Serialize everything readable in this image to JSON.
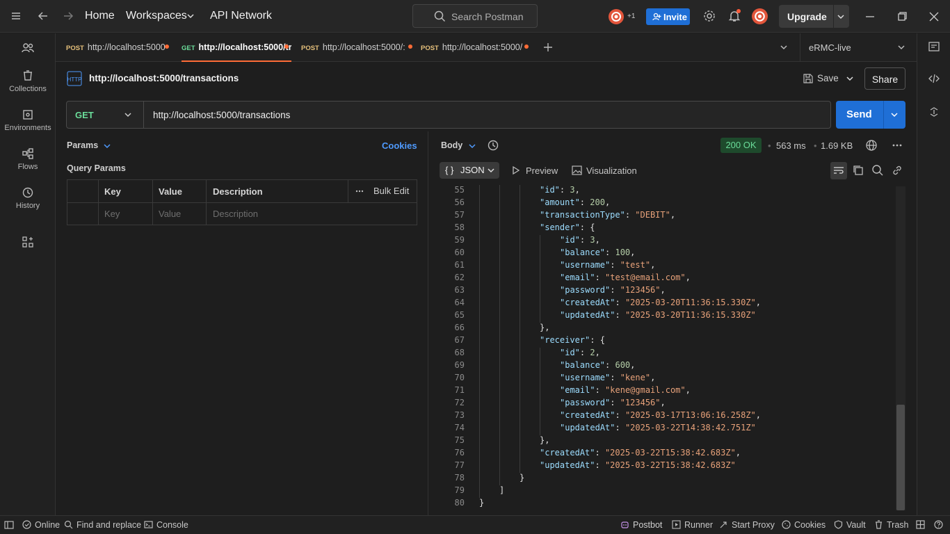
{
  "topbar": {
    "nav_home": "Home",
    "nav_workspaces": "Workspaces",
    "nav_api_network": "API Network",
    "search_placeholder": "Search Postman",
    "collab_count": "+1",
    "invite_label": "Invite",
    "upgrade_label": "Upgrade"
  },
  "sidebar": {
    "items": [
      {
        "label": "Collections",
        "icon": "collections-icon"
      },
      {
        "label": "Environments",
        "icon": "environments-icon"
      },
      {
        "label": "Flows",
        "icon": "flows-icon"
      },
      {
        "label": "History",
        "icon": "history-icon"
      }
    ]
  },
  "tabs": [
    {
      "method": "POST",
      "url": "http://localhost:5000",
      "method_color": "#e5c07b"
    },
    {
      "method": "GET",
      "url": "http://localhost:5000/tr",
      "method_color": "#6bdd9a"
    },
    {
      "method": "POST",
      "url": "http://localhost:5000/:",
      "method_color": "#e5c07b"
    },
    {
      "method": "POST",
      "url": "http://localhost:5000/",
      "method_color": "#e5c07b"
    }
  ],
  "environment": {
    "selected": "eRMC-live"
  },
  "request": {
    "title": "http://localhost:5000/transactions",
    "save_label": "Save",
    "share_label": "Share",
    "method": "GET",
    "url": "http://localhost:5000/transactions",
    "send_label": "Send"
  },
  "params": {
    "label": "Params",
    "cookies_label": "Cookies",
    "query_title": "Query Params",
    "columns": [
      "Key",
      "Value",
      "Description"
    ],
    "bulk_edit": "Bulk Edit",
    "placeholders": {
      "key": "Key",
      "value": "Value",
      "description": "Description"
    }
  },
  "response": {
    "body_label": "Body",
    "status": "200 OK",
    "time": "563 ms",
    "size": "1.69 KB",
    "format": "JSON",
    "preview_label": "Preview",
    "visualization_label": "Visualization",
    "lines": [
      {
        "n": "55",
        "d": 3,
        "t": [
          [
            "k",
            "\"id\""
          ],
          [
            "p",
            ": "
          ],
          [
            "n",
            "3"
          ],
          [
            "p",
            ","
          ]
        ]
      },
      {
        "n": "56",
        "d": 3,
        "t": [
          [
            "k",
            "\"amount\""
          ],
          [
            "p",
            ": "
          ],
          [
            "n",
            "200"
          ],
          [
            "p",
            ","
          ]
        ]
      },
      {
        "n": "57",
        "d": 3,
        "t": [
          [
            "k",
            "\"transactionType\""
          ],
          [
            "p",
            ": "
          ],
          [
            "s",
            "\"DEBIT\""
          ],
          [
            "p",
            ","
          ]
        ]
      },
      {
        "n": "58",
        "d": 3,
        "t": [
          [
            "k",
            "\"sender\""
          ],
          [
            "p",
            ": {"
          ]
        ]
      },
      {
        "n": "59",
        "d": 4,
        "t": [
          [
            "k",
            "\"id\""
          ],
          [
            "p",
            ": "
          ],
          [
            "n",
            "3"
          ],
          [
            "p",
            ","
          ]
        ]
      },
      {
        "n": "60",
        "d": 4,
        "t": [
          [
            "k",
            "\"balance\""
          ],
          [
            "p",
            ": "
          ],
          [
            "n",
            "100"
          ],
          [
            "p",
            ","
          ]
        ]
      },
      {
        "n": "61",
        "d": 4,
        "t": [
          [
            "k",
            "\"username\""
          ],
          [
            "p",
            ": "
          ],
          [
            "s",
            "\"test\""
          ],
          [
            "p",
            ","
          ]
        ]
      },
      {
        "n": "62",
        "d": 4,
        "t": [
          [
            "k",
            "\"email\""
          ],
          [
            "p",
            ": "
          ],
          [
            "s",
            "\"test@email.com\""
          ],
          [
            "p",
            ","
          ]
        ]
      },
      {
        "n": "63",
        "d": 4,
        "t": [
          [
            "k",
            "\"password\""
          ],
          [
            "p",
            ": "
          ],
          [
            "s",
            "\"123456\""
          ],
          [
            "p",
            ","
          ]
        ]
      },
      {
        "n": "64",
        "d": 4,
        "t": [
          [
            "k",
            "\"createdAt\""
          ],
          [
            "p",
            ": "
          ],
          [
            "s",
            "\"2025-03-20T11:36:15.330Z\""
          ],
          [
            "p",
            ","
          ]
        ]
      },
      {
        "n": "65",
        "d": 4,
        "t": [
          [
            "k",
            "\"updatedAt\""
          ],
          [
            "p",
            ": "
          ],
          [
            "s",
            "\"2025-03-20T11:36:15.330Z\""
          ]
        ]
      },
      {
        "n": "66",
        "d": 3,
        "t": [
          [
            "p",
            "},"
          ]
        ]
      },
      {
        "n": "67",
        "d": 3,
        "t": [
          [
            "k",
            "\"receiver\""
          ],
          [
            "p",
            ": {"
          ]
        ]
      },
      {
        "n": "68",
        "d": 4,
        "t": [
          [
            "k",
            "\"id\""
          ],
          [
            "p",
            ": "
          ],
          [
            "n",
            "2"
          ],
          [
            "p",
            ","
          ]
        ]
      },
      {
        "n": "69",
        "d": 4,
        "t": [
          [
            "k",
            "\"balance\""
          ],
          [
            "p",
            ": "
          ],
          [
            "n",
            "600"
          ],
          [
            "p",
            ","
          ]
        ]
      },
      {
        "n": "70",
        "d": 4,
        "t": [
          [
            "k",
            "\"username\""
          ],
          [
            "p",
            ": "
          ],
          [
            "s",
            "\"kene\""
          ],
          [
            "p",
            ","
          ]
        ]
      },
      {
        "n": "71",
        "d": 4,
        "t": [
          [
            "k",
            "\"email\""
          ],
          [
            "p",
            ": "
          ],
          [
            "s",
            "\"kene@gmail.com\""
          ],
          [
            "p",
            ","
          ]
        ]
      },
      {
        "n": "72",
        "d": 4,
        "t": [
          [
            "k",
            "\"password\""
          ],
          [
            "p",
            ": "
          ],
          [
            "s",
            "\"123456\""
          ],
          [
            "p",
            ","
          ]
        ]
      },
      {
        "n": "73",
        "d": 4,
        "t": [
          [
            "k",
            "\"createdAt\""
          ],
          [
            "p",
            ": "
          ],
          [
            "s",
            "\"2025-03-17T13:06:16.258Z\""
          ],
          [
            "p",
            ","
          ]
        ]
      },
      {
        "n": "74",
        "d": 4,
        "t": [
          [
            "k",
            "\"updatedAt\""
          ],
          [
            "p",
            ": "
          ],
          [
            "s",
            "\"2025-03-22T14:38:42.751Z\""
          ]
        ]
      },
      {
        "n": "75",
        "d": 3,
        "t": [
          [
            "p",
            "},"
          ]
        ]
      },
      {
        "n": "76",
        "d": 3,
        "t": [
          [
            "k",
            "\"createdAt\""
          ],
          [
            "p",
            ": "
          ],
          [
            "s",
            "\"2025-03-22T15:38:42.683Z\""
          ],
          [
            "p",
            ","
          ]
        ]
      },
      {
        "n": "77",
        "d": 3,
        "t": [
          [
            "k",
            "\"updatedAt\""
          ],
          [
            "p",
            ": "
          ],
          [
            "s",
            "\"2025-03-22T15:38:42.683Z\""
          ]
        ]
      },
      {
        "n": "78",
        "d": 2,
        "t": [
          [
            "p",
            "}"
          ]
        ]
      },
      {
        "n": "79",
        "d": 1,
        "t": [
          [
            "p",
            "]"
          ]
        ]
      },
      {
        "n": "80",
        "d": 0,
        "t": [
          [
            "p",
            "}"
          ]
        ]
      }
    ]
  },
  "statusbar": {
    "online": "Online",
    "find_replace": "Find and replace",
    "console": "Console",
    "postbot": "Postbot",
    "runner": "Runner",
    "start_proxy": "Start Proxy",
    "cookies": "Cookies",
    "vault": "Vault",
    "trash": "Trash"
  }
}
